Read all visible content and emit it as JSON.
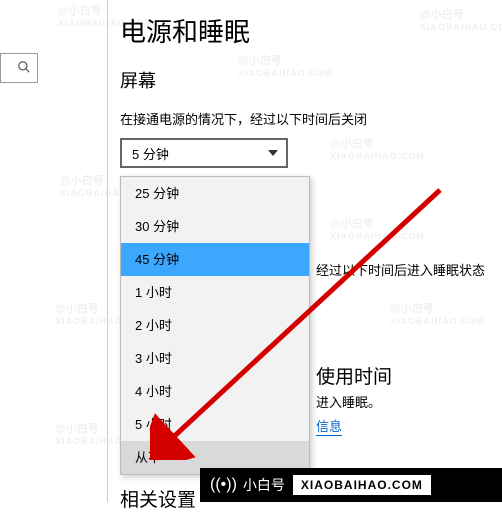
{
  "page_title": "电源和睡眠",
  "section_screen": "屏幕",
  "screen_desc": "在接通电源的情况下，经过以下时间后关闭",
  "screen_select_value": "5 分钟",
  "dropdown_options": [
    {
      "label": "25 分钟",
      "state": ""
    },
    {
      "label": "30 分钟",
      "state": ""
    },
    {
      "label": "45 分钟",
      "state": "sel"
    },
    {
      "label": "1 小时",
      "state": ""
    },
    {
      "label": "2 小时",
      "state": ""
    },
    {
      "label": "3 小时",
      "state": ""
    },
    {
      "label": "4 小时",
      "state": ""
    },
    {
      "label": "5 小时",
      "state": ""
    },
    {
      "label": "从不",
      "state": "hover"
    }
  ],
  "sleep_label": "经过以下时间后进入睡眠状态",
  "usage_title": "使用时间",
  "usage_text": "进入睡眠。",
  "info_link": "信息",
  "related_title": "相关设置",
  "watermark_cn": "@小白号",
  "watermark_en": "XIAOBAIHAO.COM",
  "banner_brand": "小白号",
  "banner_domain": "XIAOBAIHAO.COM"
}
